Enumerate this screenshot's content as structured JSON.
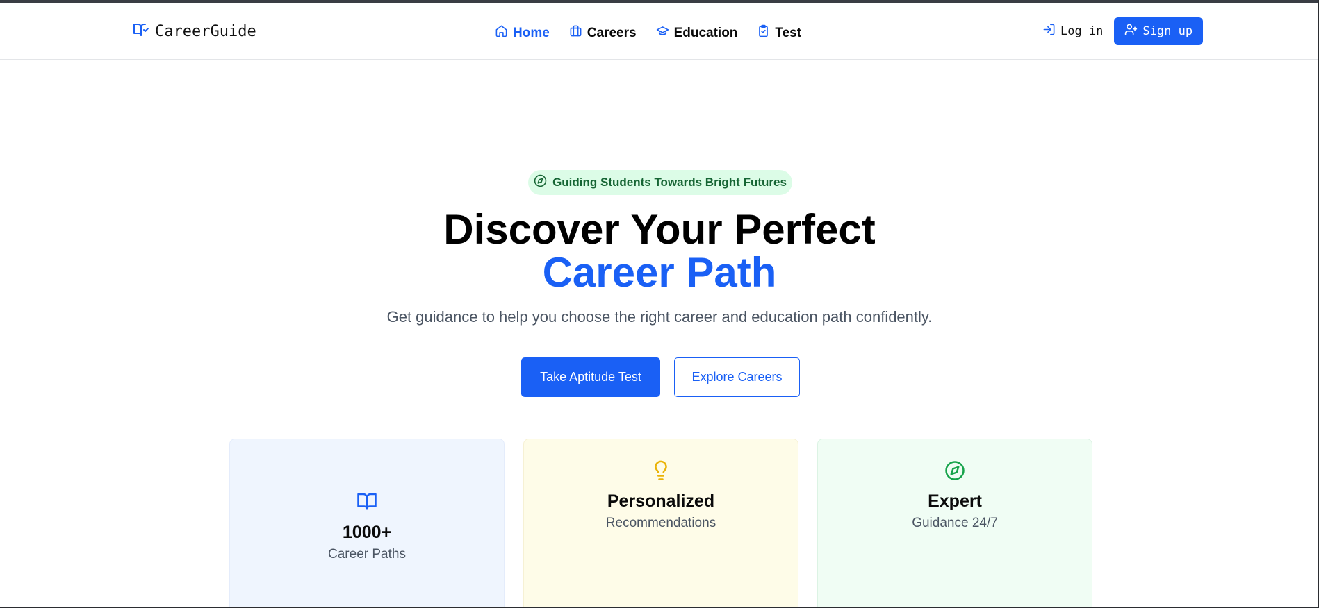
{
  "brand": {
    "name": "CareerGuide",
    "icon": "book-check-icon"
  },
  "nav": {
    "items": [
      {
        "label": "Home",
        "icon": "home-icon",
        "active": true
      },
      {
        "label": "Careers",
        "icon": "briefcase-icon",
        "active": false
      },
      {
        "label": "Education",
        "icon": "graduation-cap-icon",
        "active": false
      },
      {
        "label": "Test",
        "icon": "clipboard-check-icon",
        "active": false
      }
    ]
  },
  "auth": {
    "login_label": "Log in",
    "signup_label": "Sign up"
  },
  "hero": {
    "badge": "Guiding Students Towards Bright Futures",
    "title_line1": "Discover Your Perfect",
    "title_line2": "Career Path",
    "subtitle": "Get guidance to help you choose the right career and education path confidently.",
    "primary_cta": "Take Aptitude Test",
    "secondary_cta": "Explore Careers"
  },
  "stats": [
    {
      "title": "1000+",
      "subtitle": "Career Paths",
      "icon": "book-open-icon",
      "color": "#1a60f5"
    },
    {
      "title": "Personalized",
      "subtitle": "Recommendations",
      "icon": "lightbulb-icon",
      "color": "#eab308"
    },
    {
      "title": "Expert",
      "subtitle": "Guidance 24/7",
      "icon": "compass-icon",
      "color": "#16a34a"
    }
  ],
  "colors": {
    "accent": "#1a60f5",
    "badge_bg": "#dcfce7",
    "badge_text": "#166534"
  }
}
